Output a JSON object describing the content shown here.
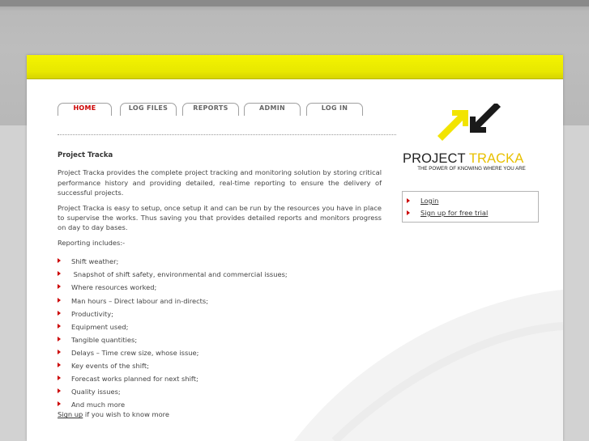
{
  "nav": {
    "tabs": [
      {
        "label": "HOME",
        "active": true
      },
      {
        "label": "LOG FILES",
        "active": false
      },
      {
        "label": "REPORTS",
        "active": false
      },
      {
        "label": "ADMIN",
        "active": false
      },
      {
        "label": "LOG IN",
        "active": false
      }
    ]
  },
  "content": {
    "title": "Project Tracka",
    "para1": "Project Tracka provides the complete project tracking and monitoring solution by storing critical performance history and providing detailed, real-time reporting to ensure the delivery of successful projects.",
    "para2": "Project Tracka is easy to setup, once setup it and can be run by the resources you have in place to supervise the works. Thus saving you that provides detailed reports and monitors progress on day to day bases.",
    "reporting_intro": "Reporting includes:-",
    "bullets": [
      "Shift weather;",
      " Snapshot of shift safety, environmental and commercial issues;",
      "Where resources worked;",
      "Man hours – Direct labour and in-directs;",
      "Productivity;",
      "Equipment used;",
      "Tangible quantities;",
      "Delays – Time crew size, whose issue;",
      "Key events of the shift;",
      "Forecast works planned for next shift;",
      "Quality issues;",
      "And much more"
    ],
    "signup_link": "Sign up",
    "signup_rest": " if you wish to know more"
  },
  "logo": {
    "word1": "PROJECT",
    "word2": "TRACKA",
    "tagline": "THE POWER OF KNOWING WHERE YOU ARE"
  },
  "sidebar": {
    "links": [
      "Login",
      "Sign up for free trial"
    ]
  },
  "colors": {
    "accent": "#cc0000",
    "yellow": "#f4f400",
    "logo_yellow": "#e8c000"
  }
}
